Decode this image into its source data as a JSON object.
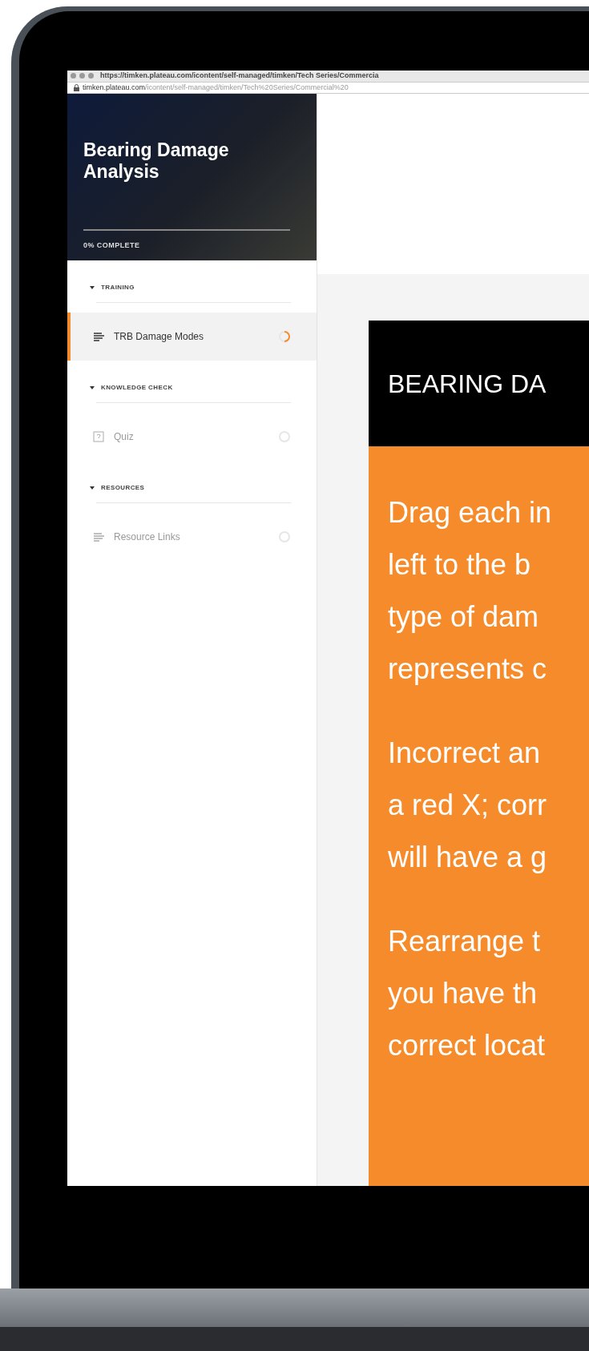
{
  "browser": {
    "title_url": "https://timken.plateau.com/icontent/self-managed/timken/Tech Series/Commercia",
    "address": {
      "host": "timken.plateau.com",
      "path": "/icontent/self-managed/timken/Tech%20Series/Commercial%20"
    }
  },
  "course": {
    "title": "Bearing Damage Analysis",
    "progress": {
      "level": 0,
      "label": "0% COMPLETE"
    }
  },
  "sections": [
    {
      "title": "TRAINING",
      "expanded": true,
      "items": [
        {
          "label": "TRB Damage Modes",
          "kind": "lesson",
          "selected": true,
          "started": true
        }
      ]
    },
    {
      "title": "KNOWLEDGE CHECK",
      "expanded": true,
      "items": [
        {
          "label": "Quiz",
          "kind": "quiz",
          "selected": false,
          "started": false
        }
      ]
    },
    {
      "title": "RESOURCES",
      "expanded": true,
      "items": [
        {
          "label": "Resource Links",
          "kind": "lesson",
          "selected": false,
          "started": false
        }
      ]
    }
  ],
  "content": {
    "heading": "BEARING DA",
    "paragraphs": [
      [
        "Drag each in",
        "left to the b",
        "type of dam",
        "represents c"
      ],
      [
        "Incorrect an",
        "a red X; corr",
        "will have a g"
      ],
      [
        "Rearrange t",
        "you have th",
        "correct locat"
      ]
    ]
  }
}
